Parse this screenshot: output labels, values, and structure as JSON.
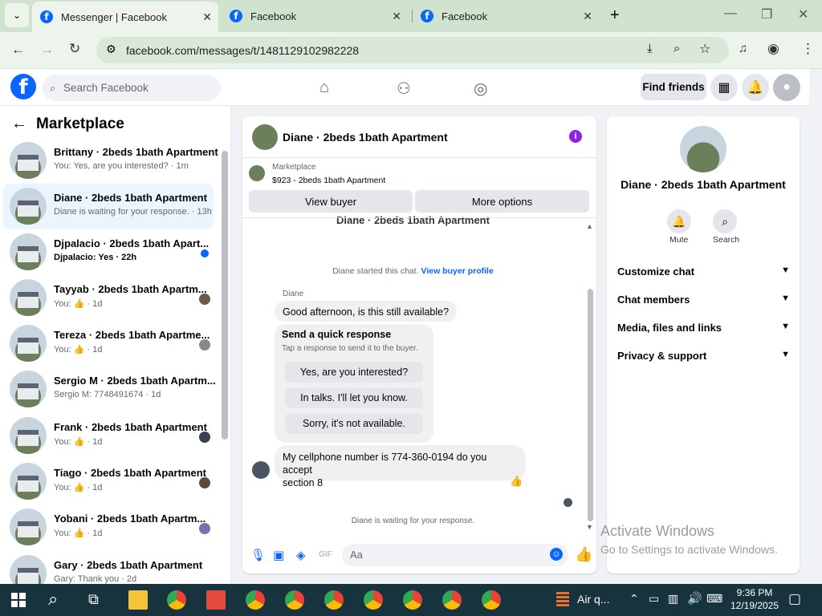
{
  "browser": {
    "tabs": [
      {
        "title": "Messenger | Facebook",
        "active": true
      },
      {
        "title": "Facebook",
        "active": false
      },
      {
        "title": "Facebook",
        "active": false
      }
    ],
    "url": "facebook.com/messages/t/1481129102982228"
  },
  "fb_header": {
    "search_placeholder": "Search Facebook",
    "find_friends": "Find friends"
  },
  "left_panel": {
    "title": "Marketplace",
    "conversations": [
      {
        "name": "Brittany · 2beds 1bath Apartment",
        "preview": "You: Yes, are you interested? · 1m"
      },
      {
        "name": "Diane · 2beds 1bath Apartment",
        "preview": "Diane is waiting for your response. · 13h"
      },
      {
        "name": "Djpalacio · 2beds 1bath Apart...",
        "preview": "Djpalacio: Yes · 22h"
      },
      {
        "name": "Tayyab · 2beds 1bath Apartm...",
        "preview": "You: 👍 · 1d"
      },
      {
        "name": "Tereza · 2beds 1bath Apartme...",
        "preview": "You: 👍 · 1d"
      },
      {
        "name": "Sergio M · 2beds 1bath Apartm...",
        "preview": "Sergio M: 7748491674 · 1d"
      },
      {
        "name": "Frank · 2beds 1bath Apartment",
        "preview": "You: 👍 · 1d"
      },
      {
        "name": "Tiago · 2beds 1bath Apartment",
        "preview": "You: 👍 · 1d"
      },
      {
        "name": "Yobani · 2beds 1bath Apartm...",
        "preview": "You: 👍 · 1d"
      },
      {
        "name": "Gary · 2beds 1bath Apartment",
        "preview": "Gary: Thank you · 2d"
      }
    ]
  },
  "chat": {
    "title": "Diane · 2beds 1bath Apartment",
    "listing_label": "Marketplace",
    "listing_price": "$923 - 2beds 1bath Apartment",
    "view_buyer": "View buyer",
    "more_options": "More options",
    "cut_name": "Diane · 2beds 1bath Apartment",
    "started_text": "Diane started this chat.",
    "view_buyer_profile": "View buyer profile",
    "sender": "Diane",
    "msg1": "Good afternoon, is this still available?",
    "quick_title": "Send a quick response",
    "quick_sub": "Tap a response to send it to the buyer.",
    "quick_responses": [
      "Yes, are you interested?",
      "In talks. I'll let you know.",
      "Sorry, it's not available."
    ],
    "msg2_line1": "My cellphone number is 774-360-0194  do you accept",
    "msg2_line2": "section  8",
    "waiting": "Diane is waiting for your response.",
    "input_placeholder": "Aa"
  },
  "right_panel": {
    "name": "Diane · 2beds 1bath Apartment",
    "mute": "Mute",
    "search": "Search",
    "rows": [
      "Customize chat",
      "Chat members",
      "Media, files and links",
      "Privacy & support"
    ]
  },
  "watermark": {
    "line1": "Activate Windows",
    "line2": "Go to Settings to activate Windows."
  },
  "taskbar": {
    "air_quality": "Air q...",
    "time": "9:36 PM",
    "date": "12/19/2025"
  }
}
